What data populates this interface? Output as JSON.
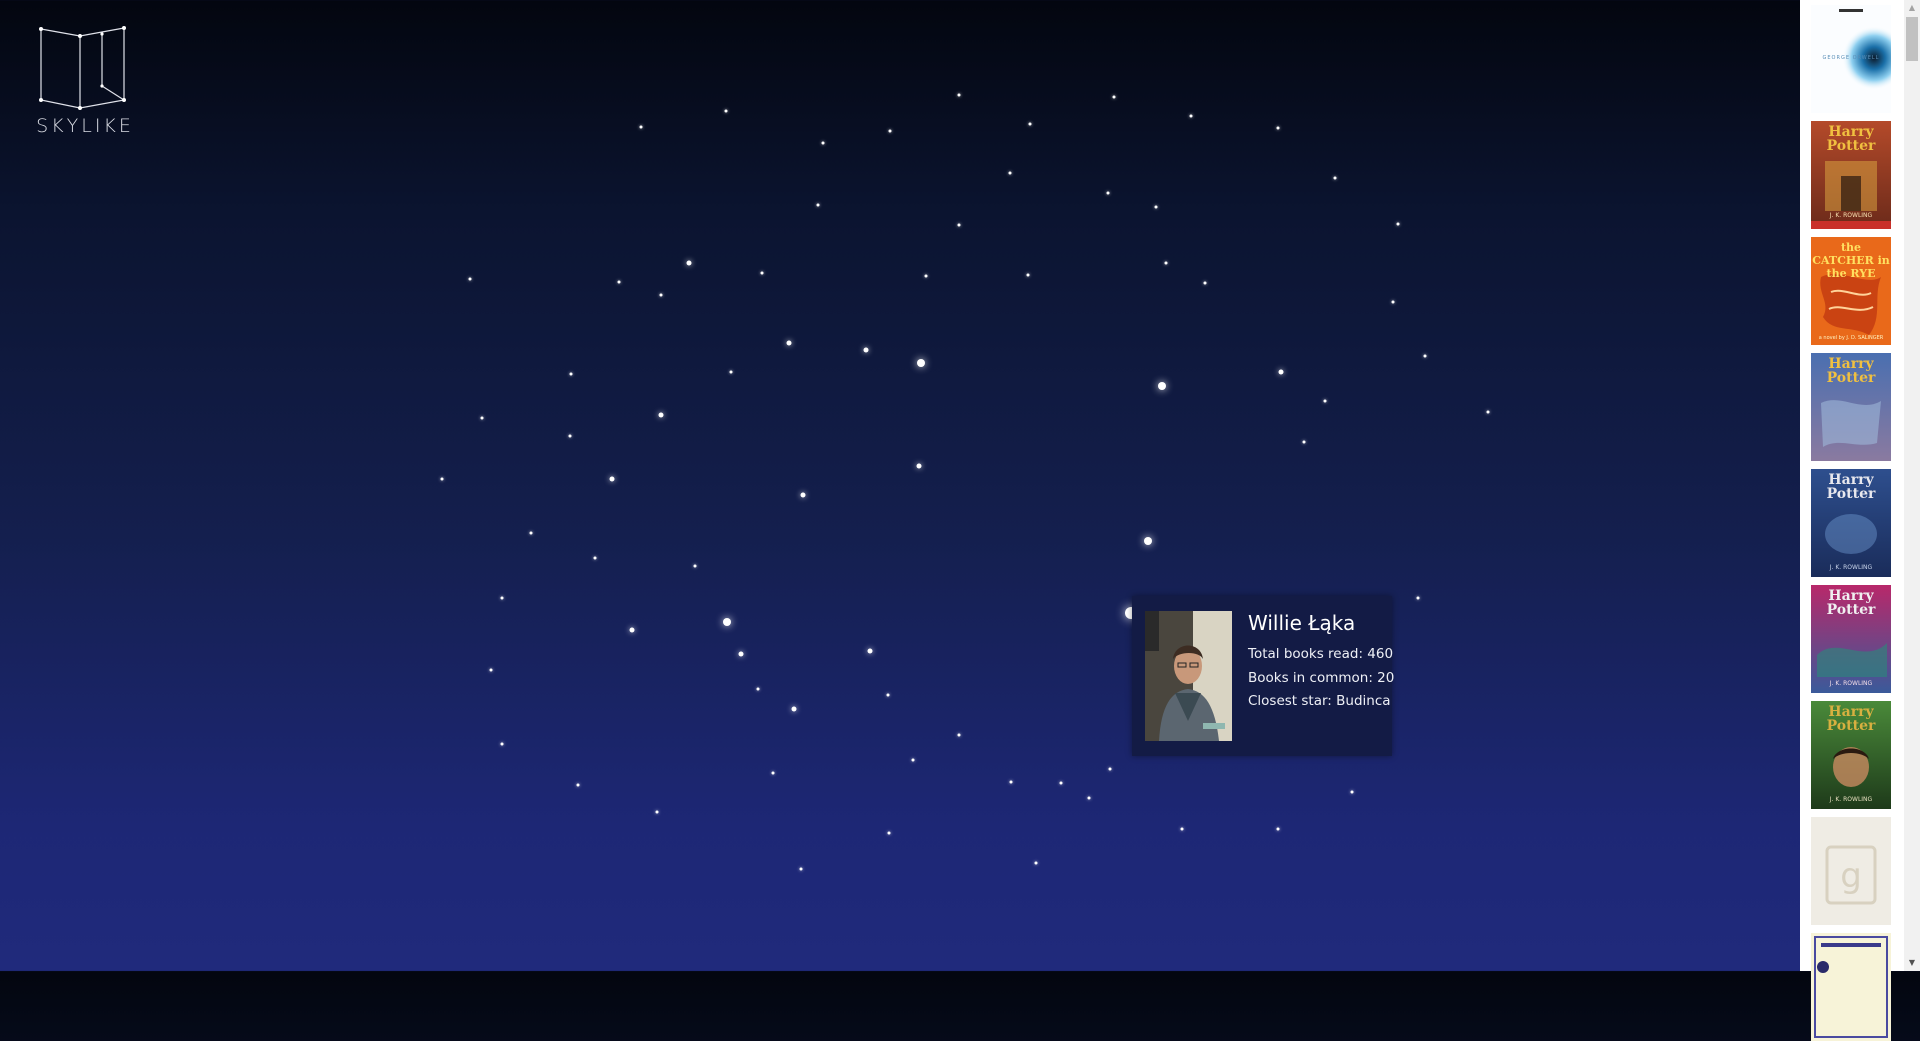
{
  "logo": {
    "text": "SKYLIKE",
    "icon": "open-book-constellation-icon"
  },
  "colors": {
    "sky_top": "#03060f",
    "sky_bottom": "#202a7c",
    "star": "#ffffff",
    "tooltip_bg": "#131b45"
  },
  "tooltip": {
    "name": "Willie Łąka",
    "total_books": "Total books read: 460",
    "books_in_common": "Books in common: 20",
    "closest_star": "Closest star: Budinca",
    "photo": "user-portrait"
  },
  "sidebar_books": [
    {
      "title": "",
      "author": "GEORGE ORWELL"
    },
    {
      "title": "Harry Potter",
      "author": "J. K. ROWLING"
    },
    {
      "title": "the CATCHER in the RYE",
      "author": "a novel by J. D. SALINGER"
    },
    {
      "title": "Harry Potter",
      "author": ""
    },
    {
      "title": "Harry Potter",
      "author": "J. K. ROWLING"
    },
    {
      "title": "Harry Potter",
      "author": "J. K. ROWLING"
    },
    {
      "title": "Harry Potter",
      "author": "J. K. ROWLING"
    },
    {
      "title": "",
      "author": "",
      "placeholder_icon": "goodreads-g-icon"
    },
    {
      "title": "",
      "author": ""
    }
  ]
}
